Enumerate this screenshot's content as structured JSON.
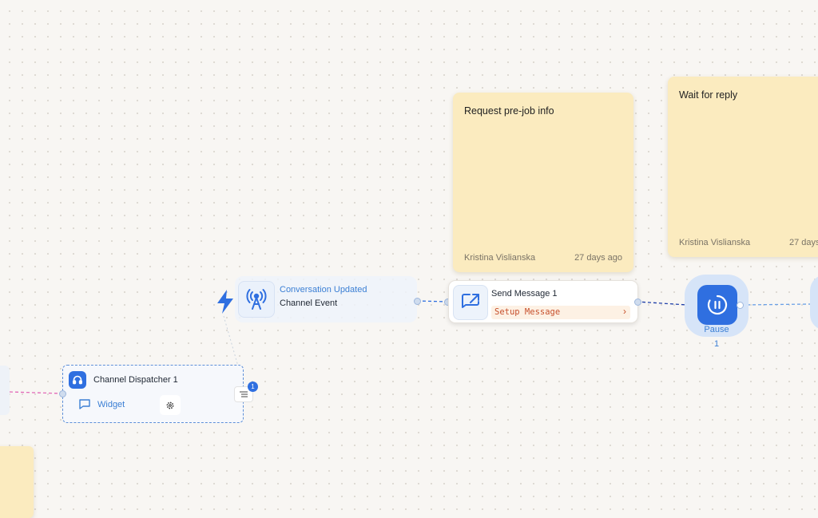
{
  "notes": [
    {
      "title": "Request pre-job info",
      "author": "Kristina Vislianska",
      "time": "27 days ago"
    },
    {
      "title": "Wait for reply",
      "author": "Kristina Vislianska",
      "time": "27 days"
    }
  ],
  "trigger": {
    "type": "Conversation Updated",
    "title": "Channel Event",
    "icon": "antenna-icon"
  },
  "send_message": {
    "title": "Send Message 1",
    "setup": "Setup Message",
    "chevron": "›"
  },
  "pause": {
    "label": "Pause",
    "count": "1"
  },
  "dispatcher": {
    "title": "Channel Dispatcher 1",
    "widget": "Widget",
    "badge": "1"
  },
  "colors": {
    "accent": "#2f6fe0",
    "note": "#fbebbf",
    "setup_text": "#c7502c"
  }
}
